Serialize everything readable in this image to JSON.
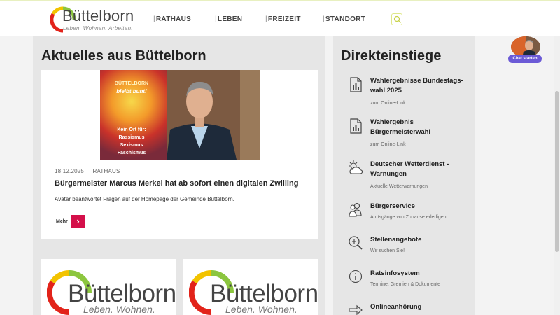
{
  "header": {
    "logo_word": "Büttelborn",
    "logo_tagline": "Leben. Wohnen. Arbeiten.",
    "nav": [
      "RATHAUS",
      "LEBEN",
      "FREIZEIT",
      "STANDORT"
    ]
  },
  "news": {
    "heading": "Aktuelles aus Büttelborn",
    "date": "18.12.2025",
    "category": "RATHAUS",
    "title": "Bürgermeister Marcus Merkel hat ab sofort einen digitalen Zwilling",
    "teaser": "Avatar beantwortet Fragen auf der Homepage der Gemeinde Büttelborn.",
    "more_label": "Mehr",
    "poster_text": [
      "BÜTTELBORN",
      "bleibt bunt!",
      "Kein Ort für:",
      "Rassismus",
      "Sexismus",
      "Faschismus"
    ]
  },
  "logo_cards": [
    {
      "word": "Büttelborn",
      "tagline": "Leben. Wohnen. Arbeiten."
    },
    {
      "word": "Büttelborn",
      "tagline": "Leben. Wohnen. Arbeiten."
    }
  ],
  "direct": {
    "heading": "Direkteinstiege",
    "entries": [
      {
        "title": "Wahlergebnisse Bundestags-wahl 2025",
        "sub": "zum Online-Link",
        "icon": "document-chart-icon"
      },
      {
        "title": "Wahlergebnis Bürgermeisterwahl",
        "sub": "zum Online-Link",
        "icon": "document-chart-icon"
      },
      {
        "title": "Deutscher Wetterdienst - Warnungen",
        "sub": "Aktuelle Wetterwarnungen",
        "icon": "weather-icon"
      },
      {
        "title": "Bürgerservice",
        "sub": "Amtsgänge von Zuhause erledigen",
        "icon": "people-icon"
      },
      {
        "title": "Stellenangebote",
        "sub": "Wir suchen Sie!",
        "icon": "zoom-icon"
      },
      {
        "title": "Ratsinfosystem",
        "sub": "Termine, Gremien & Dokumente",
        "icon": "info-icon"
      },
      {
        "title": "Onlineanhörung",
        "sub": "",
        "icon": "arrow-right-icon"
      }
    ]
  },
  "chat": {
    "label": "Chat starten"
  },
  "colors": {
    "accent": "#d4104a",
    "chat": "#6b5ad6",
    "logo_green": "#8cc63f",
    "logo_yellow": "#f2c300",
    "logo_red": "#e2231a"
  }
}
